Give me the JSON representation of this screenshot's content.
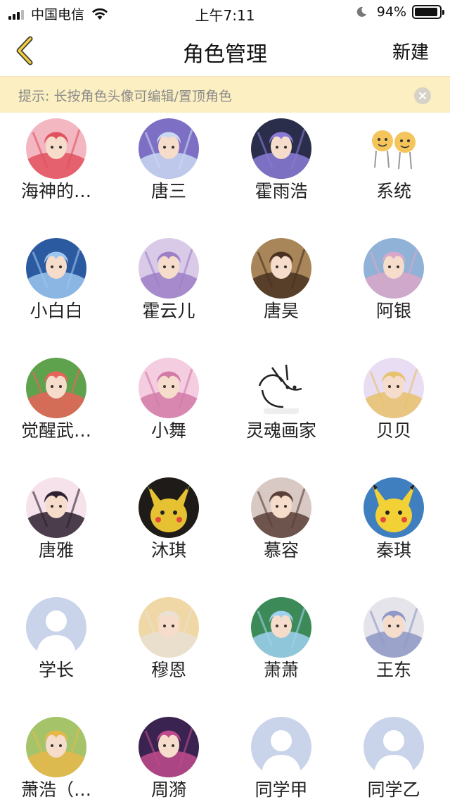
{
  "status_bar": {
    "carrier": "中国电信",
    "time": "上午7:11",
    "battery": "94%",
    "battery_level": 0.94
  },
  "nav": {
    "title": "角色管理",
    "new_label": "新建"
  },
  "tip": {
    "text": "提示: 长按角色头像可编辑/置顶角色"
  },
  "roles": [
    {
      "name": "海神的…",
      "avatar": {
        "bg": "#f3b7c2",
        "fg": "#e0525e",
        "kind": "art"
      }
    },
    {
      "name": "唐三",
      "avatar": {
        "bg": "#7c6fc4",
        "fg": "#c9d8f2",
        "kind": "art"
      }
    },
    {
      "name": "霍雨浩",
      "avatar": {
        "bg": "#2a2e4a",
        "fg": "#8b7bd8",
        "kind": "art"
      }
    },
    {
      "name": "系统",
      "avatar": {
        "bg": "#ffffff",
        "fg": "#f3c55a",
        "kind": "emoji"
      }
    },
    {
      "name": "小白白",
      "avatar": {
        "bg": "#2b5aa0",
        "fg": "#9cc6ef",
        "kind": "art"
      }
    },
    {
      "name": "霍云儿",
      "avatar": {
        "bg": "#d9cbe8",
        "fg": "#9e7fc6",
        "kind": "art"
      }
    },
    {
      "name": "唐昊",
      "avatar": {
        "bg": "#a8865a",
        "fg": "#4a3222",
        "kind": "art"
      }
    },
    {
      "name": "阿银",
      "avatar": {
        "bg": "#8fb2d6",
        "fg": "#d9a7c9",
        "kind": "art"
      }
    },
    {
      "name": "觉醒武…",
      "avatar": {
        "bg": "#5fa24d",
        "fg": "#e8645a",
        "kind": "art"
      }
    },
    {
      "name": "小舞",
      "avatar": {
        "bg": "#f4cde0",
        "fg": "#d27aa8",
        "kind": "art"
      }
    },
    {
      "name": "灵魂画家",
      "avatar": {
        "bg": "#ffffff",
        "fg": "#222222",
        "kind": "sketch"
      }
    },
    {
      "name": "贝贝",
      "avatar": {
        "bg": "#e8ddf2",
        "fg": "#e7c26d",
        "kind": "art"
      }
    },
    {
      "name": "唐雅",
      "avatar": {
        "bg": "#f6e2ea",
        "fg": "#2d2030",
        "kind": "art"
      }
    },
    {
      "name": "沐琪",
      "avatar": {
        "bg": "#1e1b18",
        "fg": "#e6c233",
        "kind": "pika"
      }
    },
    {
      "name": "慕容",
      "avatar": {
        "bg": "#d8c9c4",
        "fg": "#5a4038",
        "kind": "art"
      }
    },
    {
      "name": "秦琪",
      "avatar": {
        "bg": "#3f7fbf",
        "fg": "#f2d136",
        "kind": "pika"
      }
    },
    {
      "name": "学长",
      "avatar": {
        "bg": "#c9d4ea",
        "fg": "#ffffff",
        "kind": "default"
      }
    },
    {
      "name": "穆恩",
      "avatar": {
        "bg": "#f0d7a6",
        "fg": "#e9e1d2",
        "kind": "art"
      }
    },
    {
      "name": "萧萧",
      "avatar": {
        "bg": "#3c8a57",
        "fg": "#9ed0f0",
        "kind": "art"
      }
    },
    {
      "name": "王东",
      "avatar": {
        "bg": "#e4e4ea",
        "fg": "#8f98c6",
        "kind": "art"
      }
    },
    {
      "name": "萧浩（…",
      "avatar": {
        "bg": "#a5c46a",
        "fg": "#e6b84a",
        "kind": "art"
      }
    },
    {
      "name": "周漪",
      "avatar": {
        "bg": "#3a2350",
        "fg": "#c04b8c",
        "kind": "art"
      }
    },
    {
      "name": "同学甲",
      "avatar": {
        "bg": "#c9d4ea",
        "fg": "#ffffff",
        "kind": "default"
      }
    },
    {
      "name": "同学乙",
      "avatar": {
        "bg": "#c9d4ea",
        "fg": "#ffffff",
        "kind": "default"
      }
    }
  ]
}
